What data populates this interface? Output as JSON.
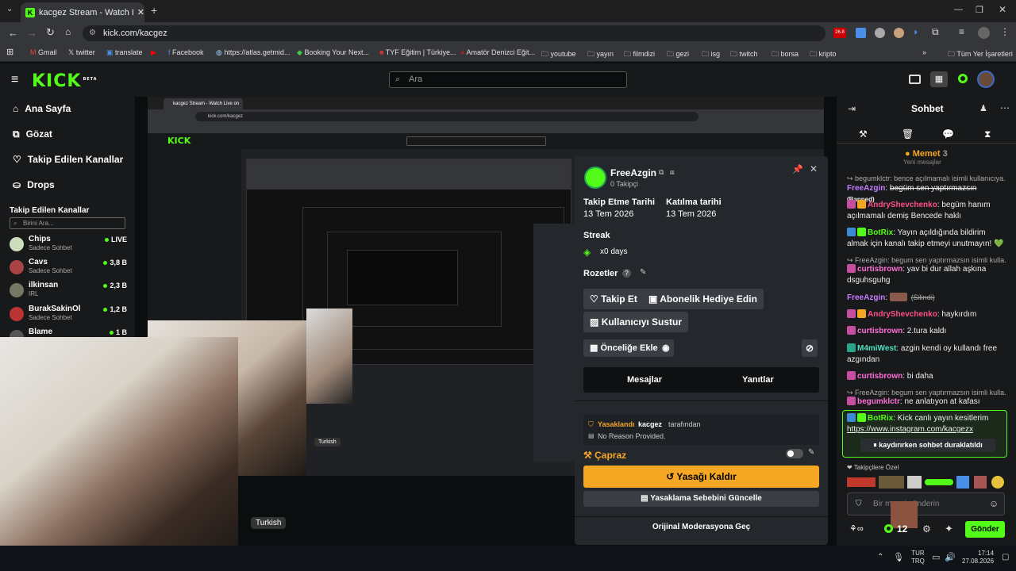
{
  "browser": {
    "tab_title": "kacgez Stream - Watch Live on",
    "url": "kick.com/kacgez",
    "bookmarks": [
      "Gmail",
      "twitter",
      "translate",
      "Facebook",
      "https://atlas.getmid...",
      "Booking Your Next...",
      "TYF Eğitim | Türkiye...",
      "Amatör Denizci Eğit...",
      "youtube",
      "yayın",
      "filmdizi",
      "gezi",
      "isg",
      "twitch",
      "borsa",
      "kripto"
    ],
    "all_bookmarks": "Tüm Yer İşaretleri"
  },
  "header": {
    "logo": "KICK",
    "beta": "BETA",
    "search_placeholder": "Ara"
  },
  "sidebar": {
    "nav": [
      {
        "label": "Ana Sayfa",
        "icon": "home-icon"
      },
      {
        "label": "Gözat",
        "icon": "browse-icon"
      },
      {
        "label": "Takip Edilen Kanallar",
        "icon": "heart-icon"
      },
      {
        "label": "Drops",
        "icon": "drops-icon"
      }
    ],
    "followed_title": "Takip Edilen Kanallar",
    "followed_search": "Birini Ara...",
    "channels": [
      {
        "name": "Chips",
        "sub": "Sadece Sohbet",
        "viewers": "LIVE",
        "color": "#cfa"
      },
      {
        "name": "Cavs",
        "sub": "Sadece Sohbet",
        "viewers": "3,8 B",
        "color": "#a44"
      },
      {
        "name": "ilkinsan",
        "sub": "IRL",
        "viewers": "2,3 B",
        "color": "#776"
      },
      {
        "name": "BurakSakinOl",
        "sub": "Sadece Sohbet",
        "viewers": "1,2 B",
        "color": "#b33"
      },
      {
        "name": "Blame",
        "sub": "",
        "viewers": "1 B",
        "color": "#555"
      }
    ]
  },
  "stream": {
    "tag": "Turkish",
    "nested_tag": "Turkish",
    "nested_tab_title": "kacgez Stream - Watch Live on",
    "nested_url": "kick.com/kacgez"
  },
  "user_card": {
    "username": "FreeAzgin",
    "followers": "0 Takipçi",
    "follow_date_label": "Takip Etme Tarihi",
    "follow_date": "13 Tem 2026",
    "join_date_label": "Katılma tarihi",
    "join_date": "13 Tem 2026",
    "streak_label": "Streak",
    "streak_value": "x0 days",
    "badges_label": "Rozetler",
    "btn_follow": "Takip Et",
    "btn_gift": "Abonelik Hediye Edin",
    "btn_mute": "Kullanıcıyı Sustur",
    "btn_priority": "Önceliğe Ekle",
    "tab_messages": "Mesajlar",
    "tab_replies": "Yanıtlar",
    "ban_status": "Yasaklandı",
    "ban_by": "kacgez",
    "ban_by_suffix": "tarafından",
    "ban_reason": "No Reason Provided.",
    "cross_label": "Çapraz",
    "btn_unban": "Yasağı Kaldır",
    "btn_update_reason": "Yasaklama Sebebini Güncelle",
    "btn_original_mod": "Orijinal Moderasyona Geç"
  },
  "chat": {
    "title": "Sohbet",
    "pinned_user": "Memet",
    "pinned_count": "3",
    "pinned_sub": "Yeni mesajlar",
    "messages": [
      {
        "type": "reply",
        "text": "begumklctr: bence açılmamalı isimli kullanıcıya..."
      },
      {
        "user": "FreeAzgin",
        "ucolor": "#c77dff",
        "text": "begüm sen yaptırmazsın",
        "extra": "(Banned)",
        "strike": true
      },
      {
        "user": "AndryShevchenko",
        "ucolor": "#ff4f8b",
        "text": "begüm hanım açılmamalı demiş Bencede haklı"
      },
      {
        "user": "BotRix",
        "ucolor": "#53fc18",
        "text": "Yayın açıldığında bildirim almak için kanalı takip etmeyi unutmayın! 💚"
      },
      {
        "type": "reply",
        "text": "FreeAzgin: begum sen yaptırmazsın isimli kulla..."
      },
      {
        "user": "curtisbrown",
        "ucolor": "#ff6fd8",
        "text": "yav bi dur allah aşkına dsguhsguhg"
      },
      {
        "user": "FreeAzgin",
        "ucolor": "#c77dff",
        "text": "(Silindi)",
        "strike": true
      },
      {
        "user": "AndryShevchenko",
        "ucolor": "#ff4f8b",
        "text": "haykırdım"
      },
      {
        "user": "curtisbrown",
        "ucolor": "#ff6fd8",
        "text": "2.tura kaldı"
      },
      {
        "user": "M4miWest",
        "ucolor": "#4fe3c1",
        "text": "azgin kendi oy kullandı free azgından"
      },
      {
        "user": "curtisbrown",
        "ucolor": "#ff6fd8",
        "text": "bi daha"
      },
      {
        "type": "reply",
        "text": "FreeAzgin: begum sen yaptırmazsın isimli kulla..."
      },
      {
        "user": "begumklctr",
        "ucolor": "#ff6fd8",
        "text": "ne anlatıyon at kafası"
      },
      {
        "user": "BotRix",
        "ucolor": "#53fc18",
        "text": "Kick canlı yayın kesitlerim",
        "link": "https://www.instagram.com/kacgezx"
      }
    ],
    "paused": "kaydırırken sohbet duraklatıldı",
    "emotes_label": "Takipçilere Özel",
    "input_placeholder": "Bir mesaj gönderin",
    "send": "Gönder",
    "chat_count": "12"
  },
  "taskbar": {
    "lang1": "TUR",
    "lang2": "TRQ",
    "time": "17:14",
    "date": "27.08.2026"
  },
  "colors": {
    "accent": "#53fc18",
    "orange": "#f5a623",
    "card_bg": "#24272c"
  }
}
